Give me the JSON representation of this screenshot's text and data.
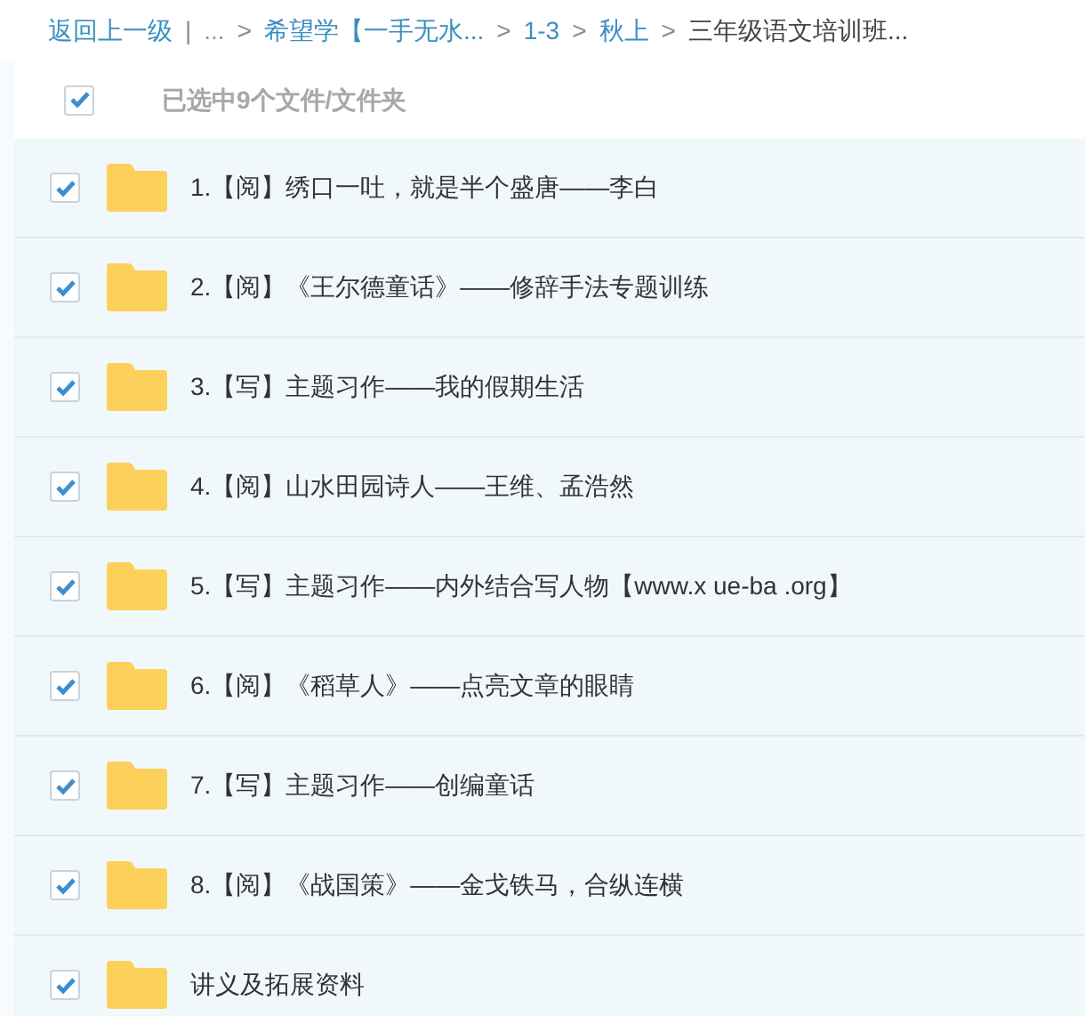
{
  "breadcrumb": [
    {
      "label": "返回上一级",
      "kind": "link"
    },
    {
      "label": "...",
      "kind": "ellipsis",
      "separator": "|"
    },
    {
      "label": "希望学【一手无水...",
      "kind": "link",
      "separator": ">"
    },
    {
      "label": "1-3",
      "kind": "link",
      "separator": ">"
    },
    {
      "label": "秋上",
      "kind": "link",
      "separator": ">"
    },
    {
      "label": "三年级语文培训班...",
      "kind": "current",
      "separator": ">"
    }
  ],
  "select_all": {
    "checked": true,
    "label": "已选中9个文件/文件夹"
  },
  "files": [
    {
      "name": "1.【阅】绣口一吐，就是半个盛唐——李白",
      "checked": true
    },
    {
      "name": "2.【阅】《王尔德童话》——修辞手法专题训练",
      "checked": true
    },
    {
      "name": "3.【写】主题习作——我的假期生活",
      "checked": true
    },
    {
      "name": "4.【阅】山水田园诗人——王维、孟浩然",
      "checked": true
    },
    {
      "name": "5.【写】主题习作——内外结合写人物【www.x ue-ba .org】",
      "checked": true
    },
    {
      "name": "6.【阅】《稻草人》——点亮文章的眼睛",
      "checked": true
    },
    {
      "name": "7.【写】主题习作——创编童话",
      "checked": true
    },
    {
      "name": "8.【阅】《战国策》——金戈铁马，合纵连横",
      "checked": true
    },
    {
      "name": "讲义及拓展资料",
      "checked": true
    }
  ]
}
